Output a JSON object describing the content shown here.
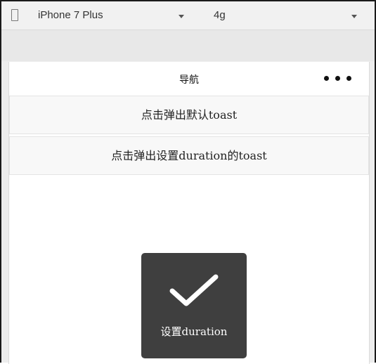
{
  "toolbar": {
    "device_icon": "phone-outline-icon",
    "device_label": "iPhone 7 Plus",
    "network_label": "4g"
  },
  "navbar": {
    "title": "导航",
    "more_icon": "more-dots-icon"
  },
  "buttons": [
    {
      "label": "点击弹出默认toast"
    },
    {
      "label": "点击弹出设置duration的toast"
    }
  ],
  "toast": {
    "icon": "checkmark-icon",
    "text": "设置duration"
  },
  "colors": {
    "toast_bg": "#3f3f3f",
    "button_bg": "#f8f8f8",
    "toolbar_bg": "#f1f1f1"
  }
}
